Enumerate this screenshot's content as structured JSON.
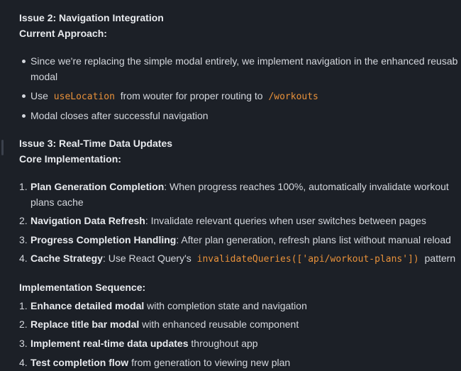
{
  "issue2": {
    "title": "Issue 2: Navigation Integration",
    "subtitle": "Current Approach:",
    "bullets": [
      {
        "line1": "Since we're replacing the simple modal entirely, we implement navigation in the enhanced reusab",
        "line2": "modal"
      },
      {
        "pre": "Use",
        "code": "useLocation",
        "mid": "from wouter for proper routing to",
        "code2": "/workouts"
      },
      {
        "text": "Modal closes after successful navigation"
      }
    ]
  },
  "issue3": {
    "title": "Issue 3: Real-Time Data Updates",
    "subtitle": "Core Implementation:",
    "items": [
      {
        "num": "1.",
        "bold": "Plan Generation Completion",
        "rest": ": When progress reaches 100%, automatically invalidate workout",
        "line2": "plans cache"
      },
      {
        "num": "2.",
        "bold": "Navigation Data Refresh",
        "rest": ": Invalidate relevant queries when user switches between pages"
      },
      {
        "num": "3.",
        "bold": "Progress Completion Handling",
        "rest": ": After plan generation, refresh plans list without manual reload"
      },
      {
        "num": "4.",
        "bold": "Cache Strategy",
        "rest": ": Use React Query's",
        "code": "invalidateQueries(['api/workout-plans'])",
        "after": "pattern"
      }
    ]
  },
  "sequence": {
    "title": "Implementation Sequence:",
    "items": [
      {
        "num": "1.",
        "bold": "Enhance detailed modal",
        "rest": " with completion state and navigation"
      },
      {
        "num": "2.",
        "bold": "Replace title bar modal",
        "rest": " with enhanced reusable component"
      },
      {
        "num": "3.",
        "bold": "Implement real-time data updates",
        "rest": " throughout app"
      },
      {
        "num": "4.",
        "bold": "Test completion flow",
        "rest": " from generation to viewing new plan"
      }
    ]
  }
}
